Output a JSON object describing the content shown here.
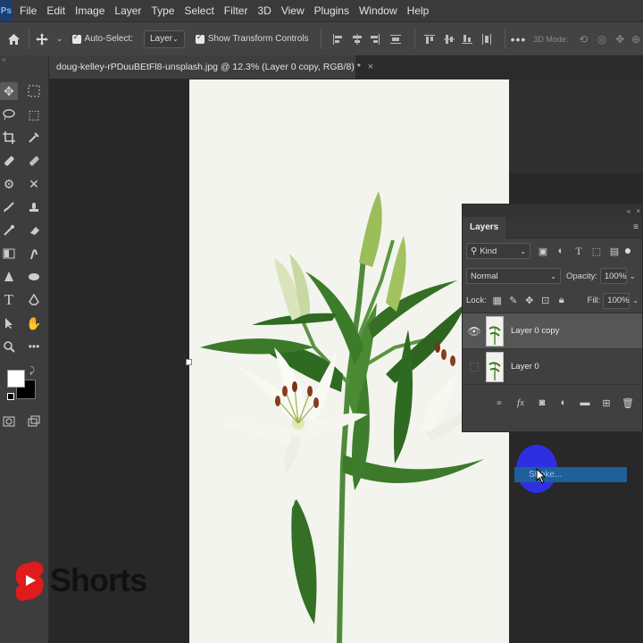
{
  "menubar": {
    "logo": "Ps",
    "items": [
      "File",
      "Edit",
      "Image",
      "Layer",
      "Type",
      "Select",
      "Filter",
      "3D",
      "View",
      "Plugins",
      "Window",
      "Help"
    ]
  },
  "options": {
    "auto_select_label": "Auto-Select:",
    "auto_select_value": "Layer",
    "show_transform_label": "Show Transform Controls",
    "three_d_mode": "3D Mode:"
  },
  "document": {
    "tab_title": "doug-kelley-rPDuuBEtFl8-unsplash.jpg @ 12.3% (Layer 0 copy, RGB/8) *",
    "close": "×"
  },
  "layers_panel": {
    "title": "Layers",
    "filter_kind": "Kind",
    "blend_mode": "Normal",
    "opacity_label": "Opacity:",
    "opacity_value": "100%",
    "lock_label": "Lock:",
    "fill_label": "Fill:",
    "fill_value": "100%",
    "layers": [
      {
        "name": "Layer 0 copy",
        "visible": true,
        "selected": true
      },
      {
        "name": "Layer 0",
        "visible": false,
        "selected": false
      }
    ]
  },
  "context_menu": {
    "stroke_label": "Stroke..."
  },
  "watermark": {
    "text": "Shorts"
  },
  "colors": {
    "menubar_bg": "#3a3a3a",
    "panel_bg": "#404040",
    "highlight_circle": "#2e2fe0",
    "menu_highlight": "#1f5f9a",
    "shorts_red": "#e01b1b"
  }
}
